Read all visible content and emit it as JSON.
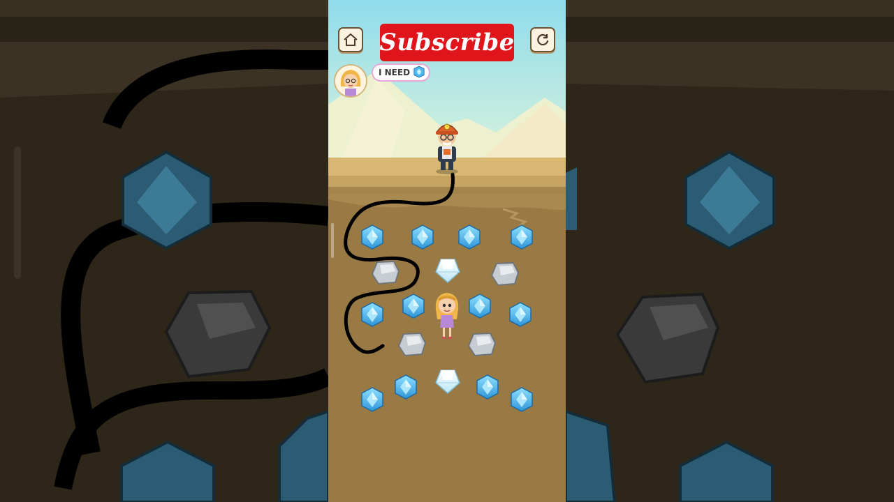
{
  "header": {
    "subscribe_label": "Subscribe",
    "home_icon": "home-icon",
    "restart_icon": "restart-icon"
  },
  "request": {
    "text": "I NEED",
    "item_icon": "blue-gem-icon"
  },
  "colors": {
    "sky_top": "#8fdcec",
    "sky_bottom": "#d9f2dc",
    "sand": "#d8b873",
    "dirt": "#9a7a44",
    "gem_blue": "#4fb8ef",
    "subscribe_red": "#e0141b",
    "drawn_path": "#000000"
  },
  "board": {
    "gems": [
      {
        "kind": "blue",
        "row": 1,
        "col": 1
      },
      {
        "kind": "blue",
        "row": 1,
        "col": 2
      },
      {
        "kind": "blue",
        "row": 1,
        "col": 3
      },
      {
        "kind": "blue",
        "row": 1,
        "col": 4
      },
      {
        "kind": "rock",
        "row": 2,
        "col": 1
      },
      {
        "kind": "diamond",
        "row": 2,
        "col": 2
      },
      {
        "kind": "rock",
        "row": 2,
        "col": 3
      },
      {
        "kind": "blue",
        "row": 3,
        "col": 1
      },
      {
        "kind": "blue",
        "row": 3,
        "col": 2
      },
      {
        "kind": "blue",
        "row": 3,
        "col": 3
      },
      {
        "kind": "blue",
        "row": 3,
        "col": 4
      },
      {
        "kind": "rock",
        "row": 4,
        "col": 1
      },
      {
        "kind": "rock",
        "row": 4,
        "col": 2
      },
      {
        "kind": "blue",
        "row": 5,
        "col": 1
      },
      {
        "kind": "blue",
        "row": 5,
        "col": 2
      },
      {
        "kind": "diamond",
        "row": 5,
        "col": 3
      },
      {
        "kind": "blue",
        "row": 5,
        "col": 4
      },
      {
        "kind": "blue",
        "row": 5,
        "col": 5
      }
    ],
    "characters": [
      "miner",
      "girl"
    ]
  }
}
